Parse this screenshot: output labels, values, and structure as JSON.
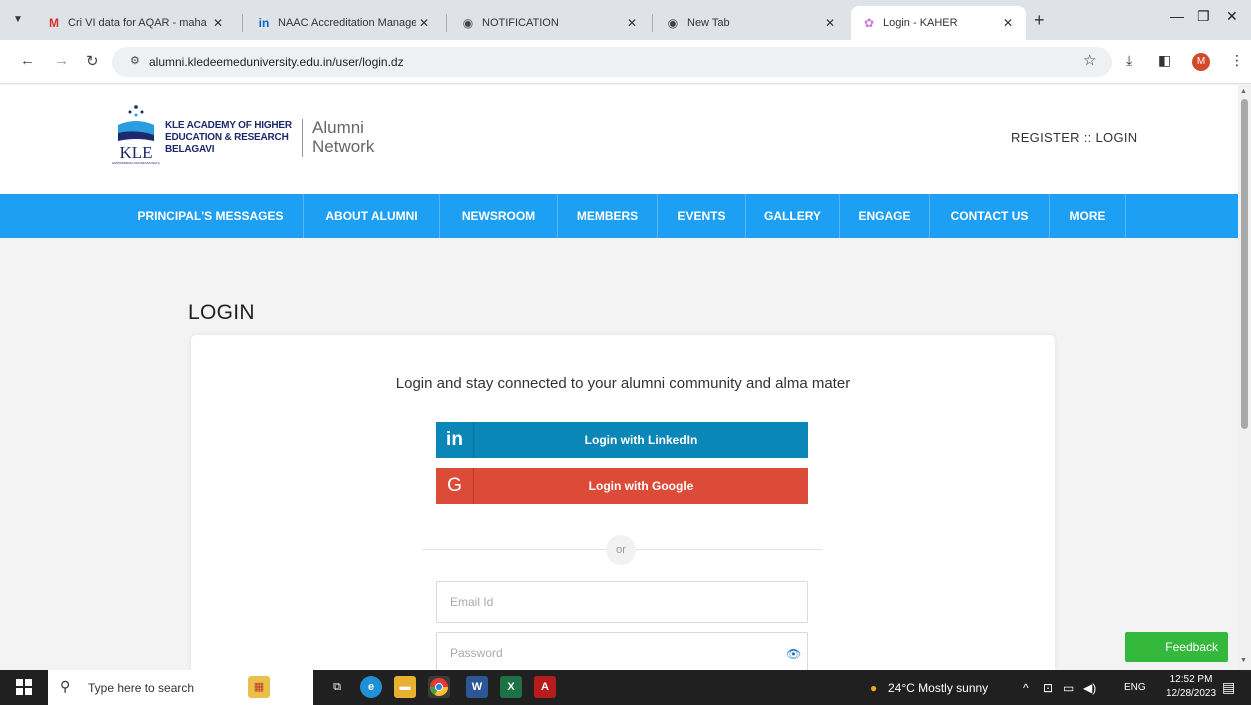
{
  "browser": {
    "tabs": [
      {
        "title": "Cri VI data for AQAR - maha",
        "icon": "gmail-icon"
      },
      {
        "title": "NAAC Accreditation Manage",
        "icon": "linkedin-icon"
      },
      {
        "title": "NOTIFICATION",
        "icon": "globe-icon"
      },
      {
        "title": "New Tab",
        "icon": "chrome-icon"
      },
      {
        "title": "Login - KAHER",
        "icon": "site-icon"
      }
    ],
    "url": "alumni.kledeemeduniversity.edu.in/user/login.dz",
    "profile_initial": "M"
  },
  "header": {
    "logo_word": "KLE",
    "logo_tagline": "EMPOWERING PROFESSIONALS",
    "org_line1": "KLE ACADEMY OF HIGHER",
    "org_line2": "EDUCATION & RESEARCH",
    "org_line3": "BELAGAVI",
    "network_line1": "Alumni",
    "network_line2": "Network",
    "register_login": "REGISTER :: LOGIN"
  },
  "nav": {
    "items": [
      "PRINCIPAL'S MESSAGES",
      "ABOUT ALUMNI",
      "NEWSROOM",
      "MEMBERS",
      "EVENTS",
      "GALLERY",
      "ENGAGE",
      "CONTACT US",
      "MORE"
    ]
  },
  "login": {
    "heading": "LOGIN",
    "tagline": "Login and stay connected to your alumni community and alma mater",
    "linkedin_label": "Login with LinkedIn",
    "google_label": "Login with Google",
    "or": "or",
    "email_placeholder": "Email Id",
    "password_placeholder": "Password"
  },
  "feedback": "Feedback",
  "taskbar": {
    "search_placeholder": "Type here to search",
    "weather": "24°C  Mostly sunny",
    "lang": "ENG",
    "time": "12:52 PM",
    "date": "12/28/2023"
  },
  "colors": {
    "nav_bg": "#1d9ff3",
    "linkedin": "#0a86b7",
    "google": "#dc4a38",
    "feedback": "#34b93d"
  }
}
